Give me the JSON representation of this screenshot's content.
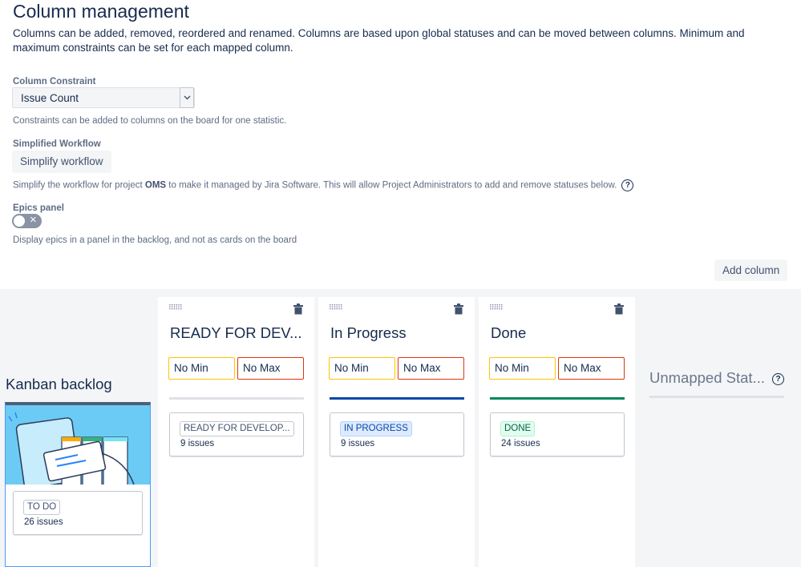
{
  "page": {
    "title": "Column management",
    "description": "Columns can be added, removed, reordered and renamed. Columns are based upon global statuses and can be moved between columns. Minimum and maximum constraints can be set for each mapped column."
  },
  "constraint": {
    "label": "Column Constraint",
    "value": "Issue Count",
    "help": "Constraints can be added to columns on the board for one statistic."
  },
  "workflow": {
    "label": "Simplified Workflow",
    "button": "Simplify workflow",
    "help_before": "Simplify the workflow for project ",
    "help_project": "OMS",
    "help_after": " to make it managed by Jira Software. This will allow Project Administrators to add and remove statuses below."
  },
  "epics": {
    "label": "Epics panel",
    "help": "Display epics in a panel in the backlog, and not as cards on the board",
    "enabled": false
  },
  "add_column_button": "Add column",
  "backlog": {
    "title": "Kanban backlog",
    "status": "TO DO",
    "count": "26 issues"
  },
  "columns": [
    {
      "title": "READY FOR DEV...",
      "min_placeholder": "No Min",
      "max_placeholder": "No Max",
      "bar_color": "#dfe1e6",
      "status": "READY FOR DEVELOP...",
      "status_color": "#42526e",
      "status_border": "#c1c7d0",
      "status_bg": "#ffffff",
      "count": "9 issues"
    },
    {
      "title": "In Progress",
      "min_placeholder": "No Min",
      "max_placeholder": "No Max",
      "bar_color": "#0747a6",
      "status": "IN PROGRESS",
      "status_color": "#0747a6",
      "status_border": "#b3d4ff",
      "status_bg": "#deebff",
      "count": "9 issues"
    },
    {
      "title": "Done",
      "min_placeholder": "No Min",
      "max_placeholder": "No Max",
      "bar_color": "#00875a",
      "status": "DONE",
      "status_color": "#006644",
      "status_border": "#abf5d1",
      "status_bg": "#e3fcef",
      "count": "24 issues"
    }
  ],
  "unmapped": {
    "title": "Unmapped Stat..."
  },
  "icons": {
    "help": "help-icon",
    "drag": "drag-handle-icon",
    "delete": "trash-icon",
    "dropdown": "chevron-down-icon"
  }
}
